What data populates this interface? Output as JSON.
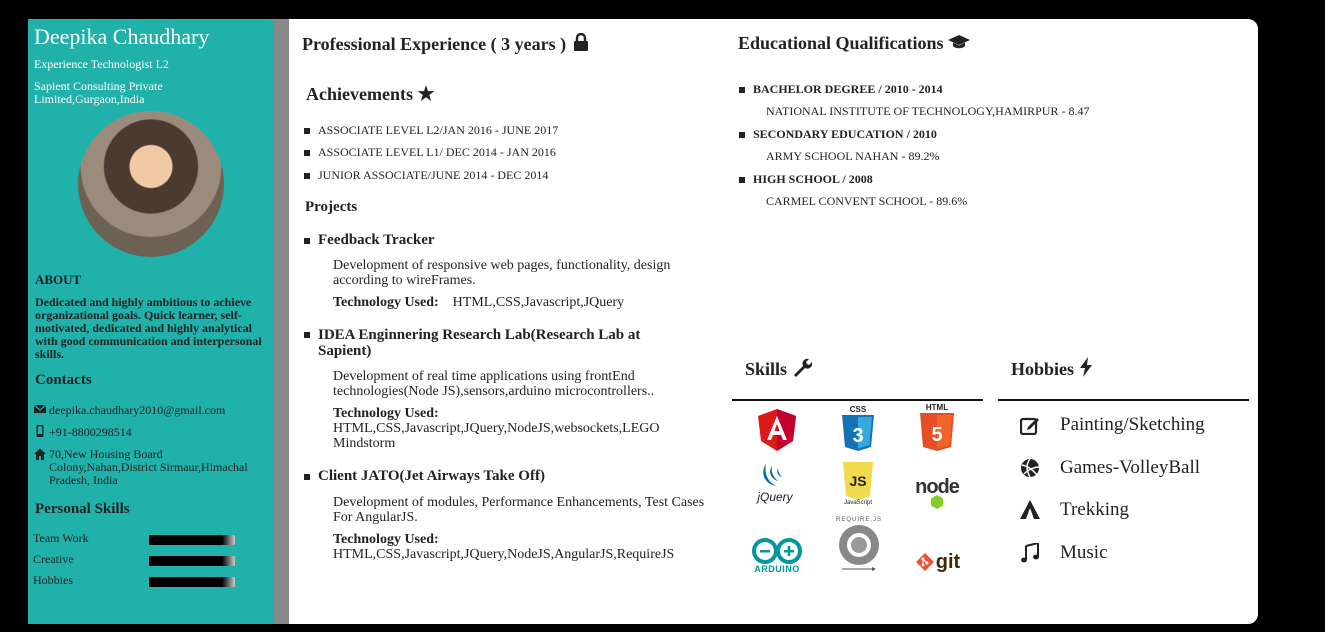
{
  "profile": {
    "name": "Deepika Chaudhary",
    "title": "Experience Technologist L2",
    "company": "Sapient Consulting Private Limited,Gurgaon,India"
  },
  "about": {
    "heading": "ABOUT",
    "text": "Dedicated and highly ambitious to achieve organizational goals. Quick learner, self-motivated, dedicated and highly analytical with good communication and interpersonal skills."
  },
  "contacts": {
    "heading": "Contacts",
    "email": "deepika.chaudhary2010@gmail.com",
    "phone": "+91-8800298514",
    "address": "70,New Housing Board Colony,Nahan,District Sirmaur,Himachal Pradesh, India"
  },
  "personal_skills": {
    "heading": "Personal Skills",
    "items": [
      {
        "label": "Team Work",
        "level": 0.85
      },
      {
        "label": "Creative",
        "level": 0.85
      },
      {
        "label": "Hobbies",
        "level": 0.85
      }
    ]
  },
  "experience": {
    "heading": "Professional Experience ( 3 years )",
    "achievements_heading": "Achievements",
    "achievements": [
      "ASSOCIATE LEVEL L2/JAN 2016 - JUNE 2017",
      "ASSOCIATE LEVEL L1/ DEC 2014 - JAN 2016",
      "JUNIOR ASSOCIATE/JUNE 2014 - DEC 2014"
    ],
    "projects_heading": "Projects",
    "tech_label": "Technology Used:",
    "projects": [
      {
        "title": "Feedback Tracker",
        "desc": "Development of responsive web pages, functionality, design according to wireFrames.",
        "tech": "HTML,CSS,Javascript,JQuery"
      },
      {
        "title": "IDEA Enginnering Research Lab(Research Lab at Sapient)",
        "desc": "Development of real time applications using frontEnd technologies(Node JS),sensors,arduino microcontrollers..",
        "tech": "HTML,CSS,Javascript,JQuery,NodeJS,websockets,LEGO Mindstorm"
      },
      {
        "title": "Client JATO(Jet Airways Take Off)",
        "desc": "Development of modules, Performance Enhancements, Test Cases For AngularJS.",
        "tech": "HTML,CSS,Javascript,JQuery,NodeJS,AngularJS,RequireJS"
      }
    ]
  },
  "education": {
    "heading": "Educational Qualifications",
    "items": [
      {
        "title": "BACHELOR DEGREE / 2010 - 2014",
        "detail": "NATIONAL INSTITUTE OF TECHNOLOGY,HAMIRPUR - 8.47"
      },
      {
        "title": "SECONDARY EDUCATION / 2010",
        "detail": "ARMY SCHOOL NAHAN - 89.2%"
      },
      {
        "title": "HIGH SCHOOL / 2008",
        "detail": "CARMEL CONVENT SCHOOL - 89.6%"
      }
    ]
  },
  "skills": {
    "heading": "Skills",
    "logos": {
      "css": "CSS",
      "html": "HTML",
      "jquery": "jQuery",
      "js": "JS",
      "js_sub": "JavaScript",
      "node": "node",
      "arduino": "ARDUINO",
      "require": "REQUIRE.JS",
      "git": "git"
    }
  },
  "hobbies": {
    "heading": "Hobbies",
    "items": [
      {
        "label": "Painting/Sketching",
        "icon": "edit-icon"
      },
      {
        "label": "Games-VolleyBall",
        "icon": "volleyball-icon"
      },
      {
        "label": "Trekking",
        "icon": "tent-icon"
      },
      {
        "label": "Music",
        "icon": "music-icon"
      }
    ]
  },
  "colors": {
    "sidebar": "#20b2aa",
    "divider": "#888888"
  }
}
